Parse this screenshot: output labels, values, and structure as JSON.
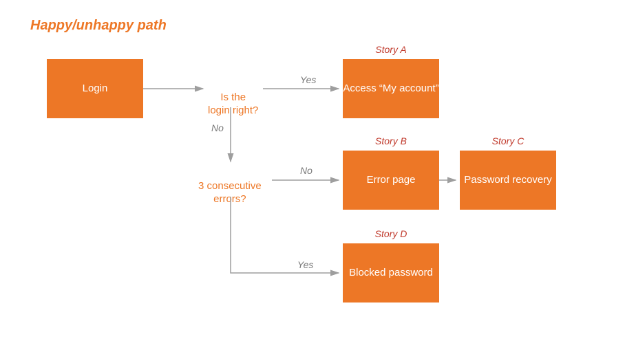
{
  "title": "Happy/unhappy path",
  "nodes": {
    "login": "Login",
    "decision1": "Is the\nlogin right?",
    "access": "Access\n“My account”",
    "decision2": "3 consecutive\nerrors?",
    "error": "Error\npage",
    "recovery": "Password\nrecovery",
    "blocked": "Blocked\npassword"
  },
  "stories": {
    "a": "Story A",
    "b": "Story B",
    "c": "Story C",
    "d": "Story D"
  },
  "edges": {
    "d1_yes": "Yes",
    "d1_no": "No",
    "d2_no": "No",
    "d2_yes": "Yes"
  },
  "colors": {
    "accent": "#ED7726",
    "story": "#C0392B",
    "arrow": "#9e9e9e"
  }
}
